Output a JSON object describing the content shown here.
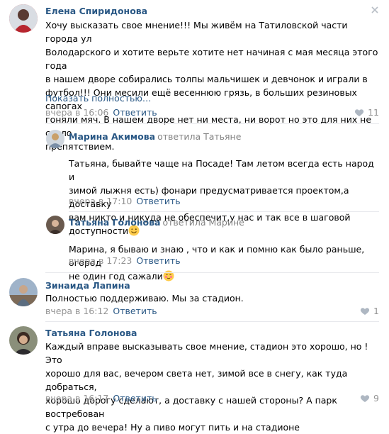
{
  "comments": [
    {
      "author": "Елена Спиридонова",
      "text": "Хочу высказать свое мнение!!! Мы живём на Татиловской части города ул\nВолодарского и хотите верьте хотите нет начиная с мая месяца этого года\nв нашем дворе собирались толпы мальчишек и девчонок и играли в\nфутбол!!! Они месили ещё весеннюю грязь, в больших резиновых сапогах\nгоняли мяч. В нашем дворе нет ни места, ни ворот но это для них не стало\nпрепятствием.",
      "show_more": "Показать полностью…",
      "date": "вчера в 16:06",
      "reply": "Ответить",
      "likes": "11"
    },
    {
      "author": "Марина Акимова",
      "replied_to": "ответила Татьяне",
      "text": "Татьяна, бывайте чаще на Посаде! Там летом всегда есть народ и\nзимой лыжня есть) фонари предусматривается проектом,а доставку\nвам никто и никуда не обеспечит,у нас и так все в шаговой\nдоступности",
      "date": "вчера в 17:10",
      "reply": "Ответить"
    },
    {
      "author": "Татьяна Голонова",
      "replied_to": "ответила Марине",
      "text": "Марина, я бываю и знаю , что и как и помню как было раньше, огород\nне один год сажали",
      "date": "вчера в 17:23",
      "reply": "Ответить"
    },
    {
      "author": "Зинаида Лапина",
      "text": "Полностью поддерживаю. Мы за стадион.",
      "date": "вчера в 16:12",
      "reply": "Ответить",
      "likes": "1"
    },
    {
      "author": "Татьяна Голонова",
      "text": "Каждый вправе высказывать свое мнение, стадион это хорошо, но ! Это\nхорошо для вас, вечером света нет, зимой все в снегу, как туда добраться,\nхорошо дорогу сделают, а доставку с нашей стороны? А парк востребован\nс утра до вечера! Ну а пиво могут пить и на стадионе",
      "date": "вчера в 16:17",
      "reply": "Ответить",
      "likes": "9"
    }
  ],
  "colors": {
    "link": "#2a5885",
    "meta": "#939393",
    "divider": "#e7e8ec"
  },
  "icons": [
    "close-icon",
    "heart-icon",
    "wink-emoji-icon",
    "blush-emoji-icon"
  ]
}
